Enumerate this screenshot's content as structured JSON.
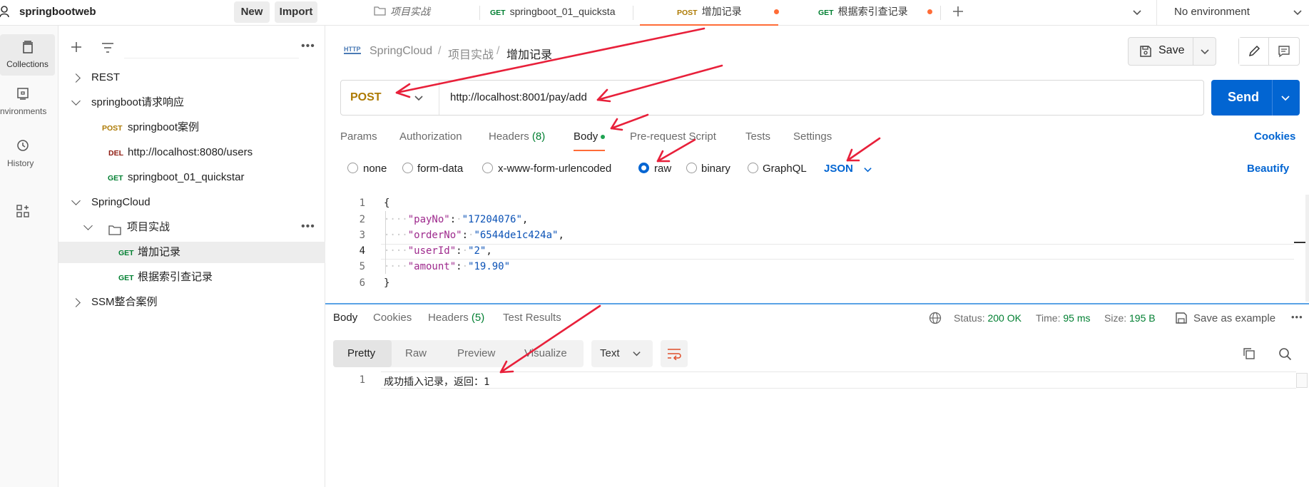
{
  "workspace": {
    "name": "springbootweb",
    "new_label": "New",
    "import_label": "Import"
  },
  "tabs": [
    {
      "method": "",
      "label": "项目实战",
      "italic": true,
      "dot": false
    },
    {
      "method": "GET",
      "label": "springboot_01_quicksta",
      "dot": false
    },
    {
      "method": "POST",
      "label": "增加记录",
      "dot": true,
      "active": true
    },
    {
      "method": "GET",
      "label": "根据索引查记录",
      "dot": true
    }
  ],
  "environment": {
    "label": "No environment"
  },
  "sidebar": {
    "items": [
      {
        "label": "Collections",
        "icon": "collections-icon"
      },
      {
        "label": "nvironments",
        "icon": "environments-icon"
      },
      {
        "label": "History",
        "icon": "history-icon"
      }
    ]
  },
  "tree": {
    "rows": [
      {
        "label": "REST"
      },
      {
        "label": "springboot请求响应"
      },
      {
        "method": "POST",
        "label": "springboot案例"
      },
      {
        "method": "DEL",
        "label": "http://localhost:8080/users"
      },
      {
        "method": "GET",
        "label": "springboot_01_quickstar"
      },
      {
        "label": "SpringCloud"
      },
      {
        "label": "项目实战"
      },
      {
        "method": "GET",
        "label": "增加记录"
      },
      {
        "method": "GET",
        "label": "根据索引查记录"
      },
      {
        "label": "SSM整合案例"
      }
    ]
  },
  "breadcrumb": {
    "icon_text": "HTTP",
    "part1": "SpringCloud",
    "part2": "项目实战",
    "current": "增加记录",
    "sep": "/"
  },
  "request": {
    "save_label": "Save",
    "method": "POST",
    "url": "http://localhost:8001/pay/add",
    "send_label": "Send",
    "subtabs": {
      "params": "Params",
      "authorization": "Authorization",
      "headers": "Headers",
      "headers_count": "(8)",
      "body": "Body",
      "prerequest": "Pre-request Script",
      "tests": "Tests",
      "settings": "Settings",
      "cookies": "Cookies"
    },
    "body_types": {
      "none": "none",
      "form_data": "form-data",
      "urlencoded": "x-www-form-urlencoded",
      "raw": "raw",
      "binary": "binary",
      "graphql": "GraphQL",
      "format": "JSON",
      "beautify": "Beautify"
    },
    "body_lines": [
      {
        "n": "1",
        "text": "{"
      },
      {
        "n": "2",
        "key": "\"payNo\"",
        "value": "\"17204076\"",
        "comma": ","
      },
      {
        "n": "3",
        "key": "\"orderNo\"",
        "value": "\"6544de1c424a\"",
        "comma": ","
      },
      {
        "n": "4",
        "key": "\"userId\"",
        "value": "\"2\"",
        "comma": ","
      },
      {
        "n": "5",
        "key": "\"amount\"",
        "value": "\"19.90\"",
        "comma": ""
      },
      {
        "n": "6",
        "text": "}"
      }
    ]
  },
  "response": {
    "tabs": {
      "body": "Body",
      "cookies": "Cookies",
      "headers": "Headers",
      "headers_count": "(5)",
      "test_results": "Test Results"
    },
    "status_label": "Status:",
    "status_value": "200 OK",
    "time_label": "Time:",
    "time_value": "95 ms",
    "size_label": "Size:",
    "size_value": "195 B",
    "save_example": "Save as example",
    "views": {
      "pretty": "Pretty",
      "raw": "Raw",
      "preview": "Preview",
      "visualize": "Visualize"
    },
    "format": "Text",
    "line_no": "1",
    "line_text": "成功插入记录，返回：1"
  },
  "colors": {
    "accent": "#0265d2",
    "orange": "#ff6c37",
    "annotation": "#e8203a",
    "status_ok": "#007f31"
  }
}
